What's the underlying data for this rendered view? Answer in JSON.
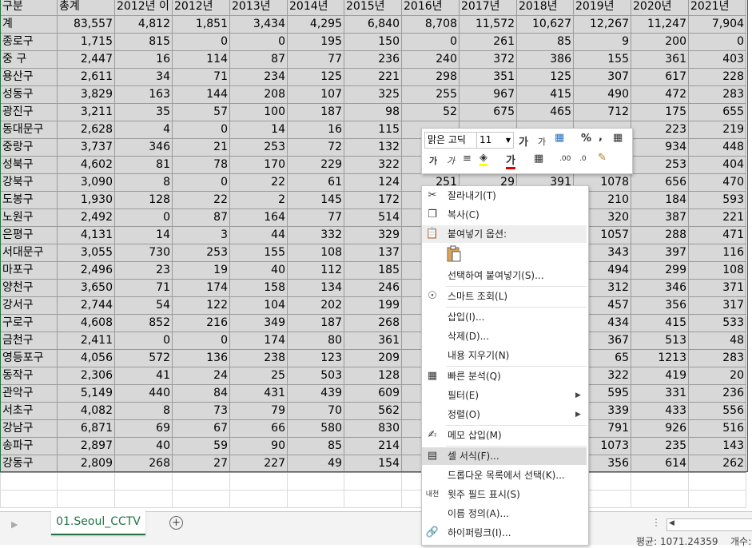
{
  "sheet": {
    "headers": [
      "구분",
      "총계",
      "2012년 이",
      "2012년",
      "2013년",
      "2014년",
      "2015년",
      "2016년",
      "2017년",
      "2018년",
      "2019년",
      "2020년",
      "2021년"
    ],
    "rows": [
      [
        "계",
        "83,557",
        "4,812",
        "1,851",
        "3,434",
        "4,295",
        "6,840",
        "8,708",
        "11,572",
        "10,627",
        "12,267",
        "11,247",
        "7,904"
      ],
      [
        "종로구",
        "1,715",
        "815",
        "0",
        "0",
        "195",
        "150",
        "0",
        "261",
        "85",
        "9",
        "200",
        "0"
      ],
      [
        "중 구",
        "2,447",
        "16",
        "114",
        "87",
        "77",
        "236",
        "240",
        "372",
        "386",
        "155",
        "361",
        "403"
      ],
      [
        "용산구",
        "2,611",
        "34",
        "71",
        "234",
        "125",
        "221",
        "298",
        "351",
        "125",
        "307",
        "617",
        "228"
      ],
      [
        "성동구",
        "3,829",
        "163",
        "144",
        "208",
        "107",
        "325",
        "255",
        "967",
        "415",
        "490",
        "472",
        "283"
      ],
      [
        "광진구",
        "3,211",
        "35",
        "57",
        "100",
        "187",
        "98",
        "52",
        "675",
        "465",
        "712",
        "175",
        "655"
      ],
      [
        "동대문구",
        "2,628",
        "4",
        "0",
        "14",
        "16",
        "115",
        "",
        "",
        "",
        "",
        "223",
        "219"
      ],
      [
        "중랑구",
        "3,737",
        "346",
        "21",
        "253",
        "72",
        "132",
        "",
        "",
        "",
        "",
        "934",
        "448"
      ],
      [
        "성북구",
        "4,602",
        "81",
        "78",
        "170",
        "229",
        "322",
        "",
        "",
        "",
        "",
        "253",
        "404"
      ],
      [
        "강북구",
        "3,090",
        "8",
        "0",
        "22",
        "61",
        "124",
        "251",
        "29",
        "391",
        "1078",
        "656",
        "470"
      ],
      [
        "도봉구",
        "1,930",
        "128",
        "22",
        "2",
        "145",
        "172",
        "",
        "",
        "",
        "210",
        "184",
        "593"
      ],
      [
        "노원구",
        "2,492",
        "0",
        "87",
        "164",
        "77",
        "514",
        "",
        "",
        "",
        "320",
        "387",
        "221"
      ],
      [
        "은평구",
        "4,131",
        "14",
        "3",
        "44",
        "332",
        "329",
        "",
        "",
        "",
        "1057",
        "288",
        "471"
      ],
      [
        "서대문구",
        "3,055",
        "730",
        "253",
        "155",
        "108",
        "137",
        "",
        "",
        "",
        "343",
        "397",
        "116"
      ],
      [
        "마포구",
        "2,496",
        "23",
        "19",
        "40",
        "112",
        "185",
        "",
        "",
        "",
        "494",
        "299",
        "108"
      ],
      [
        "양천구",
        "3,650",
        "71",
        "174",
        "158",
        "134",
        "246",
        "",
        "",
        "",
        "312",
        "346",
        "371"
      ],
      [
        "강서구",
        "2,744",
        "54",
        "122",
        "104",
        "202",
        "199",
        "",
        "",
        "",
        "457",
        "356",
        "317"
      ],
      [
        "구로구",
        "4,608",
        "852",
        "216",
        "349",
        "187",
        "268",
        "",
        "",
        "",
        "434",
        "415",
        "533"
      ],
      [
        "금천구",
        "2,411",
        "0",
        "0",
        "174",
        "80",
        "361",
        "",
        "",
        "",
        "367",
        "513",
        "48"
      ],
      [
        "영등포구",
        "4,056",
        "572",
        "136",
        "238",
        "123",
        "209",
        "",
        "",
        "",
        "65",
        "1213",
        "283"
      ],
      [
        "동작구",
        "2,306",
        "41",
        "24",
        "25",
        "503",
        "128",
        "",
        "",
        "",
        "322",
        "419",
        "20"
      ],
      [
        "관악구",
        "5,149",
        "440",
        "84",
        "431",
        "439",
        "609",
        "",
        "",
        "",
        "595",
        "331",
        "236"
      ],
      [
        "서초구",
        "4,082",
        "8",
        "73",
        "79",
        "70",
        "562",
        "",
        "",
        "",
        "339",
        "433",
        "556"
      ],
      [
        "강남구",
        "6,871",
        "69",
        "67",
        "66",
        "580",
        "830",
        "",
        "",
        "",
        "791",
        "926",
        "516"
      ],
      [
        "송파구",
        "2,897",
        "40",
        "59",
        "90",
        "85",
        "214",
        "",
        "",
        "",
        "1073",
        "235",
        "143"
      ],
      [
        "강동구",
        "2,809",
        "268",
        "27",
        "227",
        "49",
        "154",
        "",
        "",
        "",
        "356",
        "614",
        "262"
      ]
    ]
  },
  "tabs": {
    "active": "01.Seoul_CCTV",
    "add_icon": "plus-circle-icon"
  },
  "status": {
    "average": "평균: 1071.24359",
    "count": "개수:"
  },
  "mini_toolbar": {
    "font_name": "맑은 고딕",
    "font_size": "11",
    "increase_font": "가",
    "decrease_font": "가",
    "percent": "%",
    "comma": ",",
    "bold": "가",
    "italic": "가",
    "font_color_label": "가",
    "dec_increase": ".00",
    "dec_decrease": ".0"
  },
  "context_menu": {
    "cut": "잘라내기(T)",
    "copy": "복사(C)",
    "paste_options": "붙여넣기 옵션:",
    "paste_special": "선택하여 붙여넣기(S)...",
    "smart_lookup": "스마트 조회(L)",
    "insert": "삽입(I)...",
    "delete": "삭제(D)...",
    "clear": "내용 지우기(N)",
    "quick_analysis": "빠른 분석(Q)",
    "filter": "필터(E)",
    "sort": "정렬(O)",
    "insert_comment": "메모 삽입(M)",
    "format_cells": "셀 서식(F)...",
    "pick_from_list": "드롭다운 목록에서 선택(K)...",
    "phonetic": "윗주 필드 표시(S)",
    "define_name": "이름 정의(A)...",
    "hyperlink": "하이퍼링크(I)...",
    "phonetic_icon_text": "내천"
  }
}
